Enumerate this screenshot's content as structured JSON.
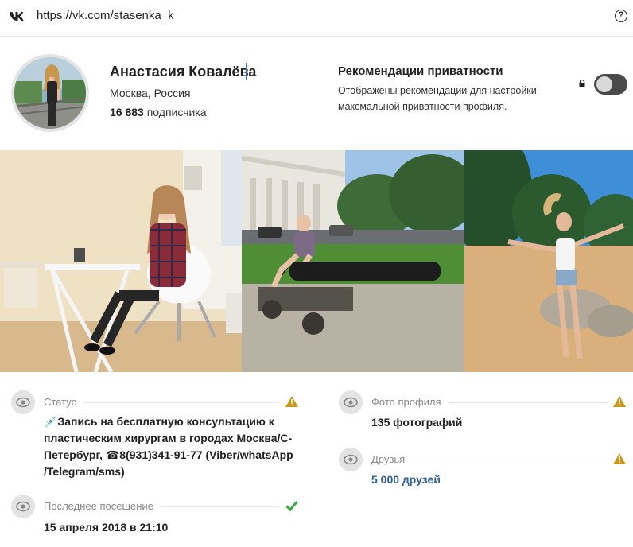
{
  "browser": {
    "url": "https://vk.com/stasenka_k",
    "help_icon": "?"
  },
  "profile": {
    "name": "Анастасия Ковалёва",
    "location": "Москва, Россия",
    "subscribers_count": "16 883",
    "subscribers_label": "подписчика"
  },
  "privacy": {
    "title": "Рекомендации приватности",
    "description": "Отображены рекомендации для настройки максмальной приватности профиля.",
    "toggle_on": false
  },
  "photos": [
    "photo-room-chair",
    "photo-cannon-park",
    "photo-beach-jump"
  ],
  "info": {
    "status": {
      "label": "Статус",
      "value": "💉Запись на бесплатную консультацию к пластическим хирургам в городах Москва/С-Петербург, ☎8(931)341-91-77 (Viber/whatsApp /Telegram/sms)",
      "indicator": "warning-icon"
    },
    "last_seen": {
      "label": "Последнее посещение",
      "value": "15 апреля 2018 в 21:10",
      "indicator": "check-icon"
    },
    "profile_photos": {
      "label": "Фото профиля",
      "value": "135 фотографий",
      "indicator": "warning-icon"
    },
    "friends": {
      "label": "Друзья",
      "value": "5 000 друзей",
      "indicator": "warning-icon"
    }
  },
  "colors": {
    "warning": "#c9971a",
    "check": "#3aa83a",
    "link": "#2f5f94",
    "toggle": "#4a4a4a"
  }
}
